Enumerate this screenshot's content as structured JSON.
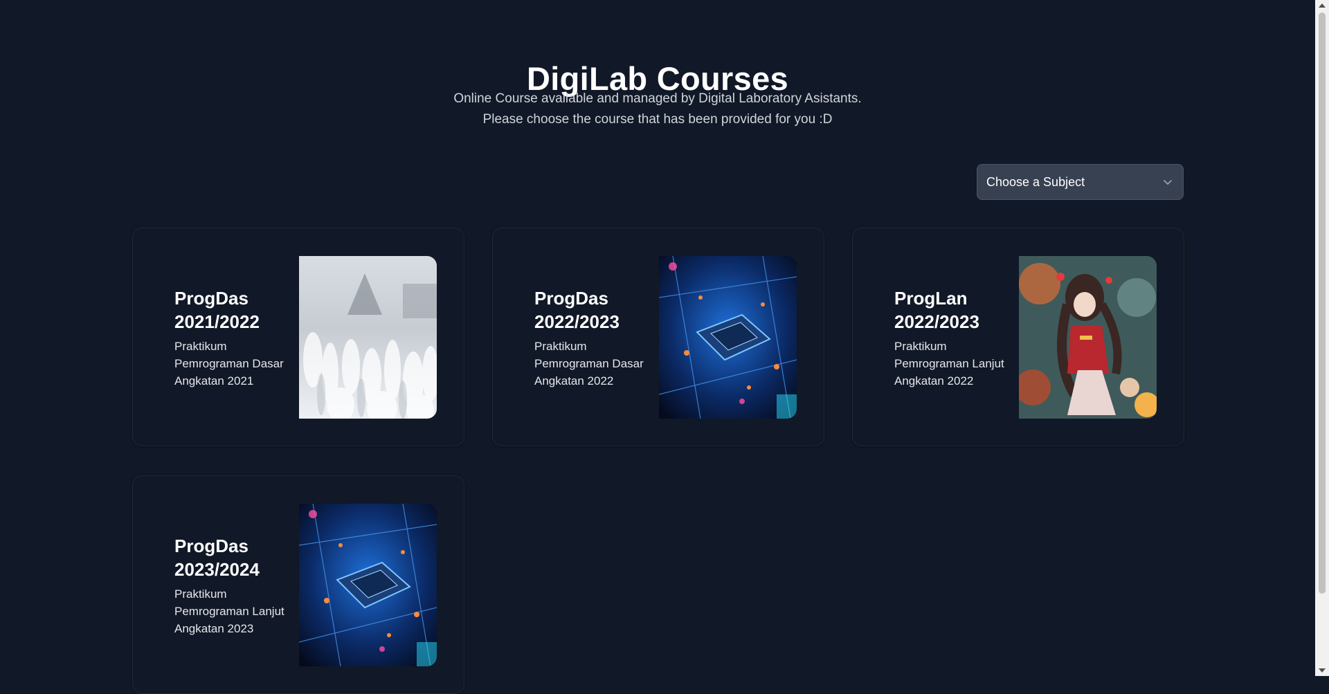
{
  "header": {
    "title": "DigiLab Courses",
    "subtitle_line1": "Online Course available and managed by Digital Laboratory Asistants.",
    "subtitle_line2": "Please choose the course that has been provided for you :D"
  },
  "filter": {
    "selected": "Choose a Subject",
    "icon": "chevron-down-icon"
  },
  "courses": [
    {
      "title_line1": "ProgDas",
      "title_line2": "2021/2022",
      "description": "Praktikum Pemrograman Dasar Angkatan 2021",
      "image": "snowy-field-photo"
    },
    {
      "title_line1": "ProgDas",
      "title_line2": "2022/2023",
      "description": "Praktikum Pemrograman Dasar Angkatan 2022",
      "image": "circuit-chip-photo"
    },
    {
      "title_line1": "ProgLan",
      "title_line2": "2022/2023",
      "description": "Praktikum Pemrograman Lanjut Angkatan 2022",
      "image": "anime-illustration"
    },
    {
      "title_line1": "ProgDas",
      "title_line2": "2023/2024",
      "description": "Praktikum Pemrograman Lanjut Angkatan 2023",
      "image": "circuit-chip-photo"
    }
  ],
  "colors": {
    "background": "#111827",
    "card_border": "#1f2937",
    "select_bg": "#374151",
    "text_muted": "#d1d5db"
  }
}
